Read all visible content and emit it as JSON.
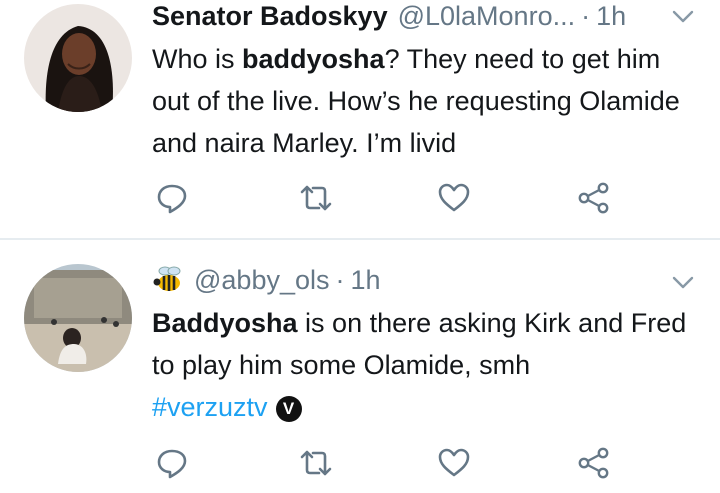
{
  "tweets": [
    {
      "display_name": "Senator Badoskyy",
      "handle": "@L0laMonro...",
      "separator": "·",
      "time": "1h",
      "body_parts": {
        "pre": "Who is ",
        "bold": "baddyosha",
        "post": "? They need to get him out of the live. How’s he requesting Olamide and naira Marley. I’m livid"
      }
    },
    {
      "emoji": "bee-icon",
      "handle": "@abby_ols",
      "separator": "·",
      "time": "1h",
      "body_parts": {
        "bold": "Baddyosha",
        "post": " is on there asking Kirk and Fred to play him some Olamide, smh",
        "hashtag": "#verzuztv",
        "badge": "V"
      }
    }
  ],
  "colors": {
    "text": "#14171a",
    "muted": "#657786",
    "link": "#1da1f2",
    "divider": "#e6ecf0"
  },
  "icons": [
    "reply-icon",
    "retweet-icon",
    "like-icon",
    "share-icon",
    "chevron-down-icon"
  ]
}
